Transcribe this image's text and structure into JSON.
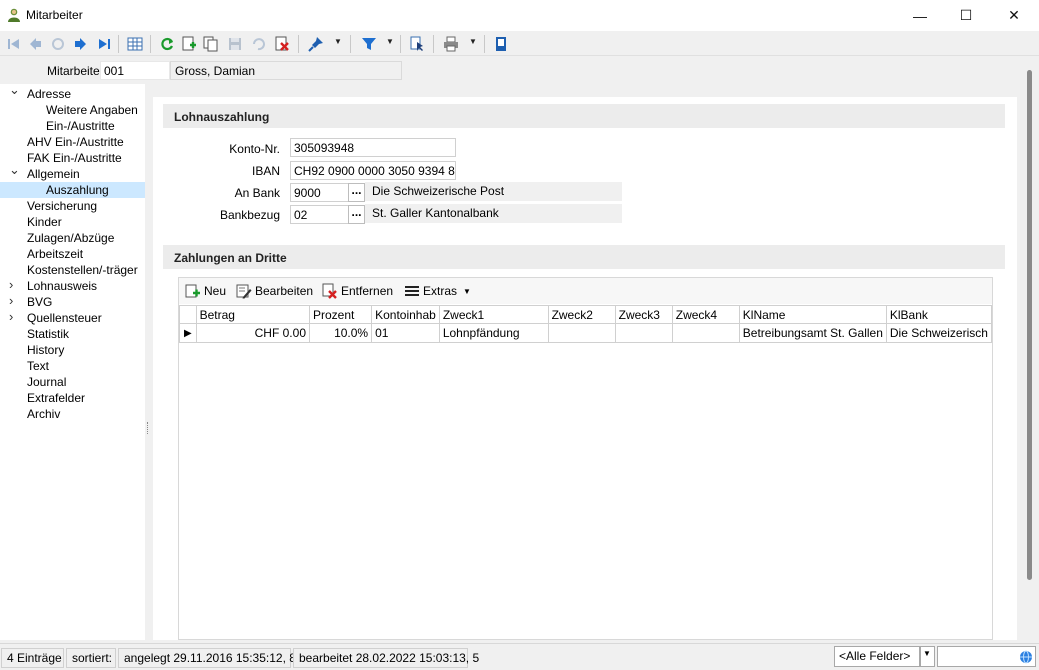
{
  "window": {
    "title": "Mitarbeiter",
    "controls": {
      "minimize": "—",
      "maximize": "☐",
      "close": "✕"
    }
  },
  "header": {
    "label": "Mitarbeiter",
    "number": "001",
    "name": "Gross, Damian"
  },
  "tree": {
    "items": [
      {
        "label": "Adresse",
        "level": 0,
        "toggle": "expanded"
      },
      {
        "label": "Weitere Angaben",
        "level": 1
      },
      {
        "label": "Ein-/Austritte",
        "level": 1
      },
      {
        "label": "AHV Ein-/Austritte",
        "level": 0
      },
      {
        "label": "FAK Ein-/Austritte",
        "level": 0
      },
      {
        "label": "Allgemein",
        "level": 0,
        "toggle": "expanded"
      },
      {
        "label": "Auszahlung",
        "level": 1,
        "selected": true
      },
      {
        "label": "Versicherung",
        "level": 0
      },
      {
        "label": "Kinder",
        "level": 0
      },
      {
        "label": "Zulagen/Abzüge",
        "level": 0
      },
      {
        "label": "Arbeitszeit",
        "level": 0
      },
      {
        "label": "Kostenstellen/-träger",
        "level": 0
      },
      {
        "label": "Lohnausweis",
        "level": 0,
        "toggle": "collapsed"
      },
      {
        "label": "BVG",
        "level": 0,
        "toggle": "collapsed"
      },
      {
        "label": "Quellensteuer",
        "level": 0,
        "toggle": "collapsed"
      },
      {
        "label": "Statistik",
        "level": 0
      },
      {
        "label": "History",
        "level": 0
      },
      {
        "label": "Text",
        "level": 0
      },
      {
        "label": "Journal",
        "level": 0
      },
      {
        "label": "Extrafelder",
        "level": 0
      },
      {
        "label": "Archiv",
        "level": 0
      }
    ]
  },
  "payout": {
    "section_title": "Lohnauszahlung",
    "konto_label": "Konto-Nr.",
    "konto_value": "305093948",
    "iban_label": "IBAN",
    "iban_value": "CH92 0900 0000 3050 9394 8",
    "bank_label": "An Bank",
    "bank_code": "9000",
    "bank_name": "Die Schweizerische Post",
    "bezug_label": "Bankbezug",
    "bezug_code": "02",
    "bezug_name": "St. Galler Kantonalbank",
    "lookup_button": "..."
  },
  "third_party": {
    "section_title": "Zahlungen an Dritte",
    "toolbar": {
      "new": "Neu",
      "edit": "Bearbeiten",
      "remove": "Entfernen",
      "extras": "Extras"
    },
    "columns": [
      "Betrag",
      "Prozent",
      "Kontoinhab",
      "Zweck1",
      "Zweck2",
      "Zweck3",
      "Zweck4",
      "KlName",
      "KlBank"
    ],
    "rows": [
      [
        "CHF 0.00",
        "10.0%",
        "01",
        "Lohnpfändung",
        "",
        "",
        "",
        "Betreibungsamt St. Gallen",
        "Die Schweizerisch"
      ]
    ]
  },
  "status": {
    "entries": "4 Einträge",
    "sorted": "sortiert:",
    "created": "angelegt 29.11.2016 15:35:12,  8",
    "edited": "bearbeitet 28.02.2022 15:03:13,  5",
    "field_filter": "<Alle Felder>"
  },
  "colors": {
    "selection": "#cce8ff",
    "accent_blue": "#1e6fd0",
    "accent_green": "#1a9a2c",
    "delete_red": "#d42020"
  }
}
